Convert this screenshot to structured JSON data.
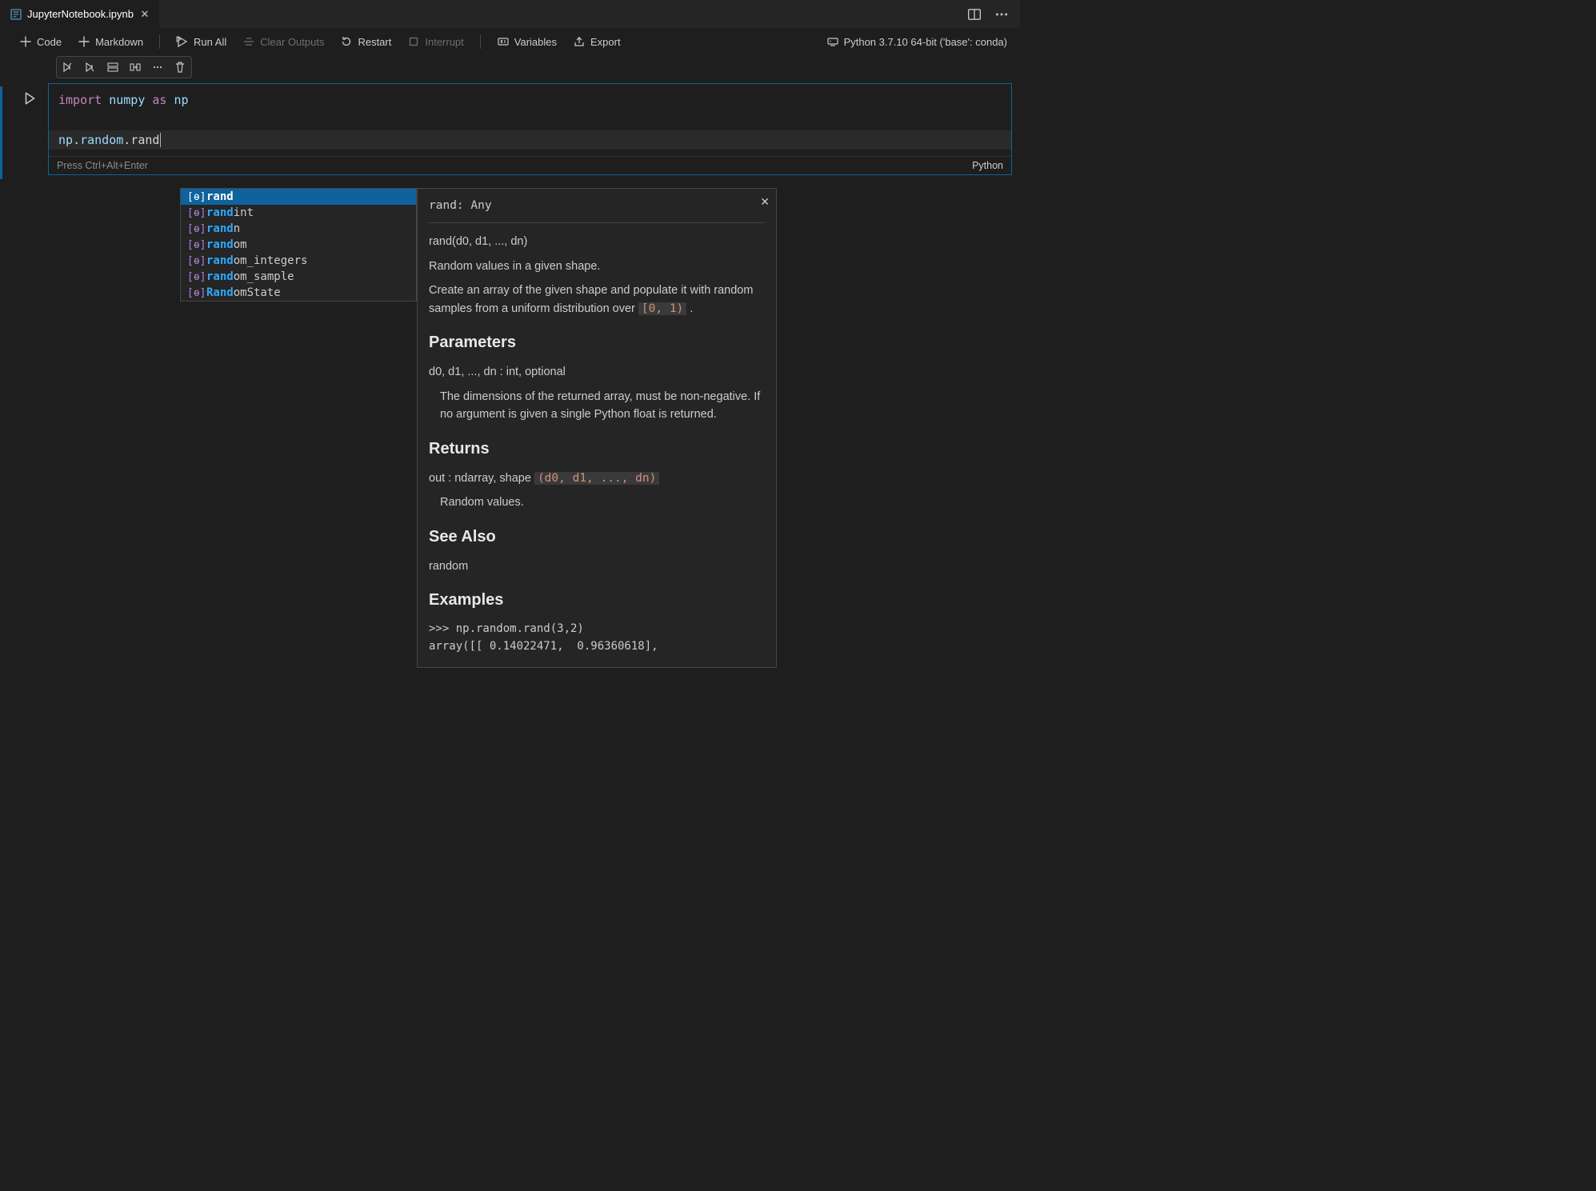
{
  "tab": {
    "filename": "JupyterNotebook.ipynb"
  },
  "toolbar": {
    "code": "Code",
    "markdown": "Markdown",
    "run_all": "Run All",
    "clear_outputs": "Clear Outputs",
    "restart": "Restart",
    "interrupt": "Interrupt",
    "variables": "Variables",
    "export": "Export",
    "kernel": "Python 3.7.10 64-bit ('base': conda)"
  },
  "cell": {
    "hint": "Press Ctrl+Alt+Enter",
    "lang": "Python",
    "code": {
      "l1_import": "import",
      "l1_numpy": "numpy",
      "l1_as": "as",
      "l1_np": "np",
      "l2_prefix": "np.random.",
      "l2_typed": "rand"
    }
  },
  "autocomplete": {
    "items": [
      {
        "match": "rand",
        "rest": ""
      },
      {
        "match": "rand",
        "rest": "int"
      },
      {
        "match": "rand",
        "rest": "n"
      },
      {
        "match": "rand",
        "rest": "om"
      },
      {
        "match": "rand",
        "rest": "om_integers"
      },
      {
        "match": "rand",
        "rest": "om_sample"
      },
      {
        "match": "Rand",
        "rest": "omState"
      }
    ]
  },
  "doc": {
    "signature": "rand: Any",
    "call": "rand(d0, d1, ..., dn)",
    "summary": "Random values in a given shape.",
    "desc_pre": "Create an array of the given shape and populate it with random samples from a uniform distribution over ",
    "desc_code": "[0, 1)",
    "desc_post": " .",
    "h_params": "Parameters",
    "params_line1": "d0, d1, ..., dn : int, optional",
    "params_line2": "The dimensions of the returned array, must be non-negative. If no argument is given a single Python float is returned.",
    "h_returns": "Returns",
    "returns_pre": "out : ndarray, shape ",
    "returns_code": "(d0, d1, ..., dn)",
    "returns_sub": "Random values.",
    "h_seealso": "See Also",
    "seealso_body": "random",
    "h_examples": "Examples",
    "ex_line1": ">>> np.random.rand(3,2)",
    "ex_line2": "array([[ 0.14022471,  0.96360618],"
  }
}
